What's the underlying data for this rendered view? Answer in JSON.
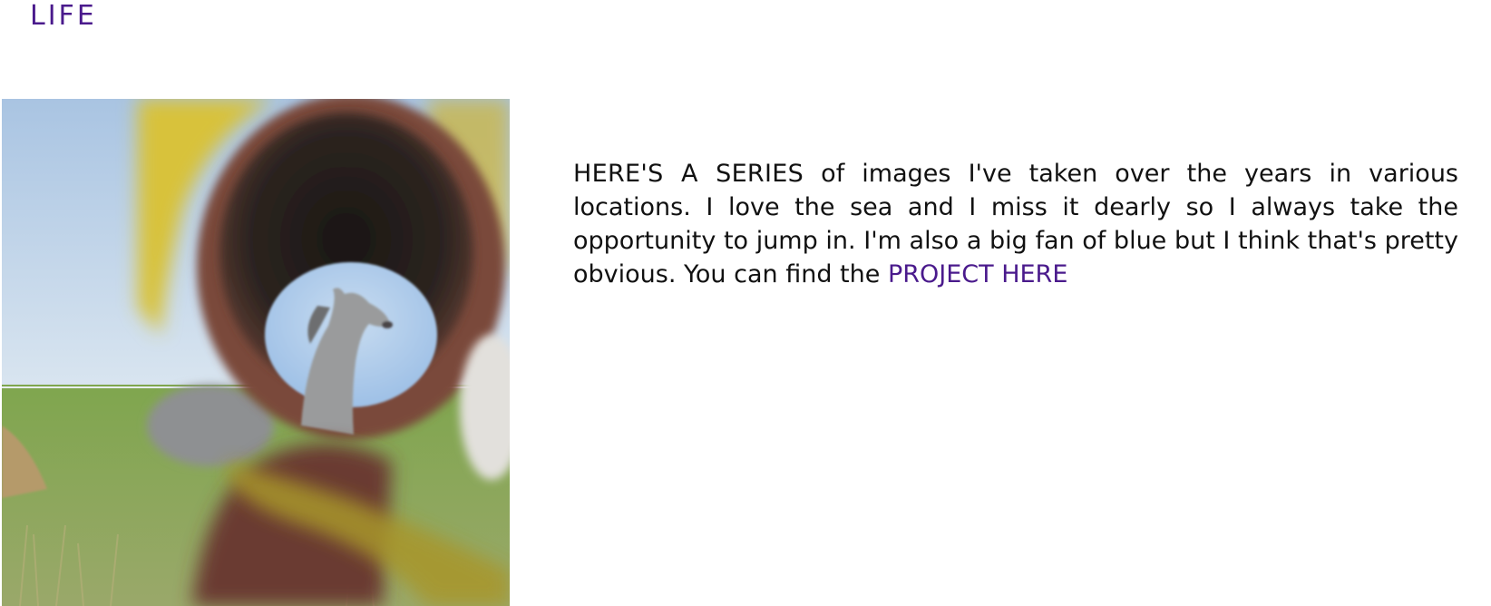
{
  "page": {
    "title": "LIFE"
  },
  "intro": {
    "lead": "HERE'S A SERIES",
    "body": " of images I've taken over the years in various locations. I love the sea and I miss it dearly so I always take the opportunity to jump in. I'm also a big fan of blue but I think that's pretty obvious. You can find the ",
    "link_label": "PROJECT HERE"
  },
  "colors": {
    "accent": "#4a1a8c",
    "text": "#111111",
    "background": "#ffffff"
  }
}
